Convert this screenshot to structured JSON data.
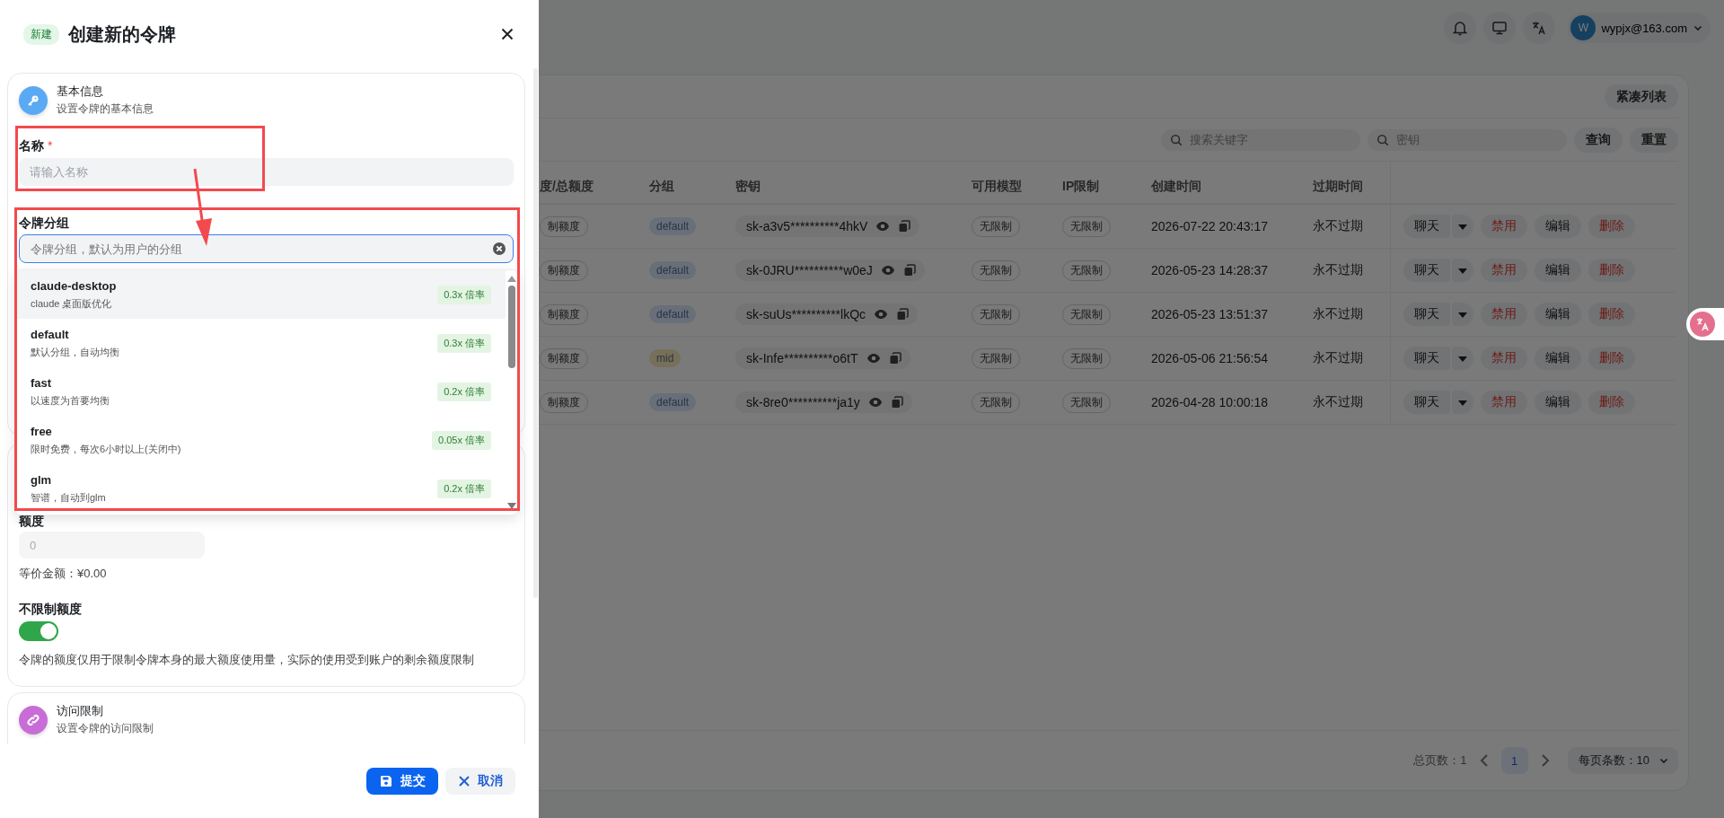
{
  "drawer": {
    "tag": "新建",
    "title": "创建新的令牌",
    "basic_section": {
      "title": "基本信息",
      "subtitle": "设置令牌的基本信息"
    },
    "name_field": {
      "label": "名称",
      "required_mark": "*",
      "placeholder": "请输入名称"
    },
    "group_field": {
      "label": "令牌分组",
      "placeholder": "令牌分组，默认为用户的分组",
      "focused": true
    },
    "group_options": [
      {
        "name": "claude-desktop",
        "description": "claude 桌面版优化",
        "ratio": "0.3x 倍率",
        "selected": true
      },
      {
        "name": "default",
        "description": "默认分组，自动均衡",
        "ratio": "0.3x 倍率",
        "selected": false
      },
      {
        "name": "fast",
        "description": "以速度为首要均衡",
        "ratio": "0.2x 倍率",
        "selected": false
      },
      {
        "name": "free",
        "description": "限时免费，每次6小时以上(关闭中)",
        "ratio": "0.05x 倍率",
        "selected": false
      },
      {
        "name": "glm",
        "description": "智谱，自动到glm",
        "ratio": "0.2x 倍率",
        "selected": false
      }
    ],
    "quota_field": {
      "label": "额度",
      "value": "0",
      "disabled": true,
      "equivalent": "等价金额：¥0.00"
    },
    "unlimited_quota": {
      "label": "不限制额度",
      "on": true,
      "note": "令牌的额度仅用于限制令牌本身的最大额度使用量，实际的使用受到账户的剩余额度限制"
    },
    "access_section": {
      "title": "访问限制",
      "subtitle": "设置令牌的访问限制"
    },
    "buttons": [
      {
        "label": "提交",
        "kind": "primary"
      },
      {
        "label": "取消",
        "kind": "secondary"
      }
    ]
  },
  "header": {
    "avatar": "W",
    "email": "wypjx@163.com"
  },
  "toolbar": {
    "compact_button": "紧凑列表",
    "keyword_placeholder": "搜索关键字",
    "key_placeholder": "密钥",
    "buttons": [
      "查询",
      "重置"
    ]
  },
  "table": {
    "columns": [
      "度/总额度",
      "分组",
      "密钥",
      "可用模型",
      "IP限制",
      "创建时间",
      "过期时间"
    ],
    "rows": [
      {
        "quota": "制额度",
        "group": {
          "text": "default",
          "color": "#687078"
        },
        "key": "sk-a3v5**********4hkV",
        "models": "无限制",
        "ip": "无限制",
        "created": "2026-07-22 20:43:17",
        "expires": "永不过期",
        "actions": [
          {
            "label": "聊天",
            "kind": "split"
          },
          {
            "label": "禁用",
            "kind": "danger"
          },
          {
            "label": "编辑",
            "kind": "normal"
          },
          {
            "label": "删除",
            "kind": "danger"
          }
        ]
      },
      {
        "quota": "制额度",
        "group": {
          "text": "default",
          "color": "#687078"
        },
        "key": "sk-0JRU**********w0eJ",
        "models": "无限制",
        "ip": "无限制",
        "created": "2026-05-23 14:28:37",
        "expires": "永不过期",
        "actions": [
          {
            "label": "聊天",
            "kind": "split"
          },
          {
            "label": "禁用",
            "kind": "danger"
          },
          {
            "label": "编辑",
            "kind": "normal"
          },
          {
            "label": "删除",
            "kind": "danger"
          }
        ]
      },
      {
        "quota": "制额度",
        "group": {
          "text": "default",
          "color": "#687078"
        },
        "key": "sk-suUs**********lkQc",
        "models": "无限制",
        "ip": "无限制",
        "created": "2026-05-23 13:51:37",
        "expires": "永不过期",
        "actions": [
          {
            "label": "聊天",
            "kind": "split"
          },
          {
            "label": "禁用",
            "kind": "danger"
          },
          {
            "label": "编辑",
            "kind": "normal"
          },
          {
            "label": "删除",
            "kind": "danger"
          }
        ]
      },
      {
        "quota": "制额度",
        "group": {
          "text": "mid",
          "color": "#77705a"
        },
        "key": "sk-Infe**********o6tT",
        "models": "无限制",
        "ip": "无限制",
        "created": "2026-05-06 21:56:54",
        "expires": "永不过期",
        "actions": [
          {
            "label": "聊天",
            "kind": "split"
          },
          {
            "label": "禁用",
            "kind": "danger"
          },
          {
            "label": "编辑",
            "kind": "normal"
          },
          {
            "label": "删除",
            "kind": "danger"
          }
        ]
      },
      {
        "quota": "制额度",
        "group": {
          "text": "default",
          "color": "#687078"
        },
        "key": "sk-8re0**********ja1y",
        "models": "无限制",
        "ip": "无限制",
        "created": "2026-04-28 10:00:18",
        "expires": "永不过期",
        "actions": [
          {
            "label": "聊天",
            "kind": "split"
          },
          {
            "label": "禁用",
            "kind": "danger"
          },
          {
            "label": "编辑",
            "kind": "normal"
          },
          {
            "label": "删除",
            "kind": "danger"
          }
        ]
      }
    ]
  },
  "pagination": {
    "total": "总页数：1",
    "pages": [
      {
        "label": "1",
        "selected": true
      }
    ],
    "page_size": "每页条数：10"
  }
}
